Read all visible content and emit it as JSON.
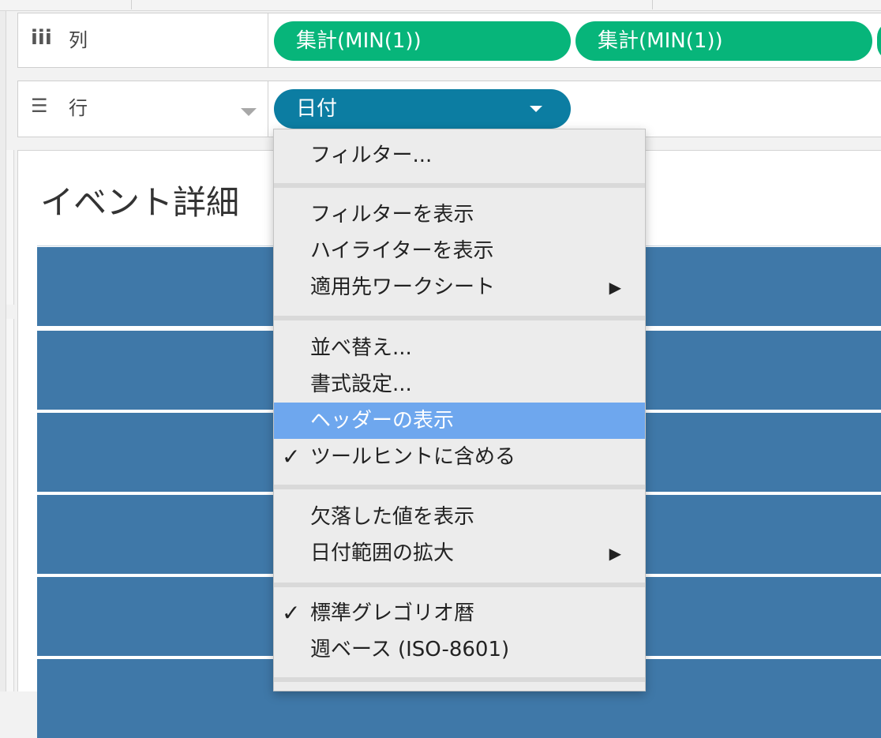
{
  "shelves": {
    "columns": {
      "label": "列",
      "pills": [
        "集計(MIN(1))",
        "集計(MIN(1))"
      ]
    },
    "rows": {
      "label": "行",
      "pill": "日付"
    }
  },
  "worksheet": {
    "title": "イベント詳細"
  },
  "menu": {
    "items": [
      {
        "label": "フィルター...",
        "checked": false,
        "submenu": false
      },
      {
        "label": "フィルターを表示",
        "checked": false,
        "submenu": false
      },
      {
        "label": "ハイライターを表示",
        "checked": false,
        "submenu": false
      },
      {
        "label": "適用先ワークシート",
        "checked": false,
        "submenu": true
      },
      {
        "label": "並べ替え...",
        "checked": false,
        "submenu": false
      },
      {
        "label": "書式設定...",
        "checked": false,
        "submenu": false
      },
      {
        "label": "ヘッダーの表示",
        "checked": false,
        "submenu": false,
        "highlighted": true
      },
      {
        "label": "ツールヒントに含める",
        "checked": true,
        "submenu": false
      },
      {
        "label": "欠落した値を表示",
        "checked": false,
        "submenu": false
      },
      {
        "label": "日付範囲の拡大",
        "checked": false,
        "submenu": true
      },
      {
        "label": "標準グレゴリオ暦",
        "checked": true,
        "submenu": false
      },
      {
        "label": "週ベース (ISO-8601)",
        "checked": false,
        "submenu": false
      }
    ],
    "check_glyph": "✓",
    "submenu_glyph": "▶"
  },
  "colors": {
    "measure_pill": "#07b57a",
    "dimension_pill": "#0c7da2",
    "row_band": "#3f78a8",
    "menu_highlight": "#6ea7ee"
  }
}
